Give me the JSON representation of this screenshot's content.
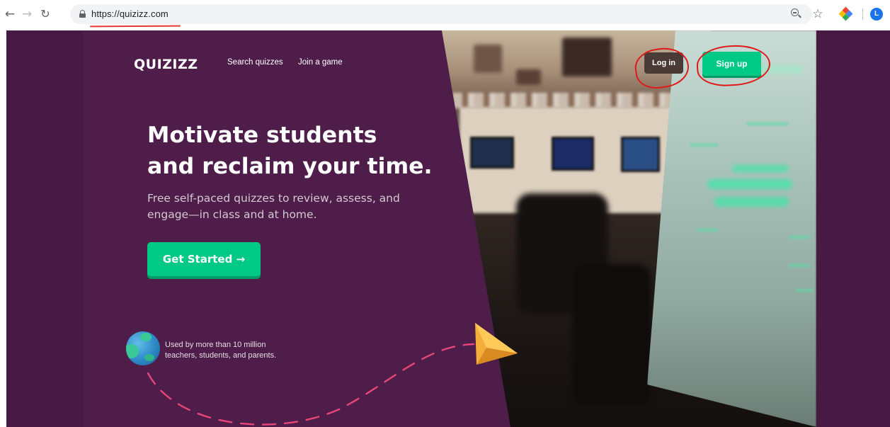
{
  "browser": {
    "url": "https://quizizz.com",
    "nav_icons": [
      "back-arrow-icon",
      "forward-arrow-icon",
      "reload-icon"
    ],
    "right_icons": [
      "zoom-icon",
      "bookmark-star-icon",
      "extension-icon",
      "profile-avatar"
    ],
    "profile_initial": "L"
  },
  "header": {
    "logo": "QUIZIZZ",
    "links": [
      "Search quizzes",
      "Join a game"
    ],
    "login_label": "Log in",
    "signup_label": "Sign up"
  },
  "hero": {
    "title_line1": "Motivate students",
    "title_line2": "and reclaim your time.",
    "subtitle": "Free self-paced quizzes to review, assess, and engage—in class and at home.",
    "cta_label": "Get Started →"
  },
  "footer": {
    "used_by_line1": "Used by more than 10 million",
    "used_by_line2": "teachers, students, and parents."
  },
  "colors": {
    "page_bg": "#461a42",
    "accent_green": "#00c985",
    "login_bg": "#4a3b37",
    "annotation_red": "#e01818"
  }
}
